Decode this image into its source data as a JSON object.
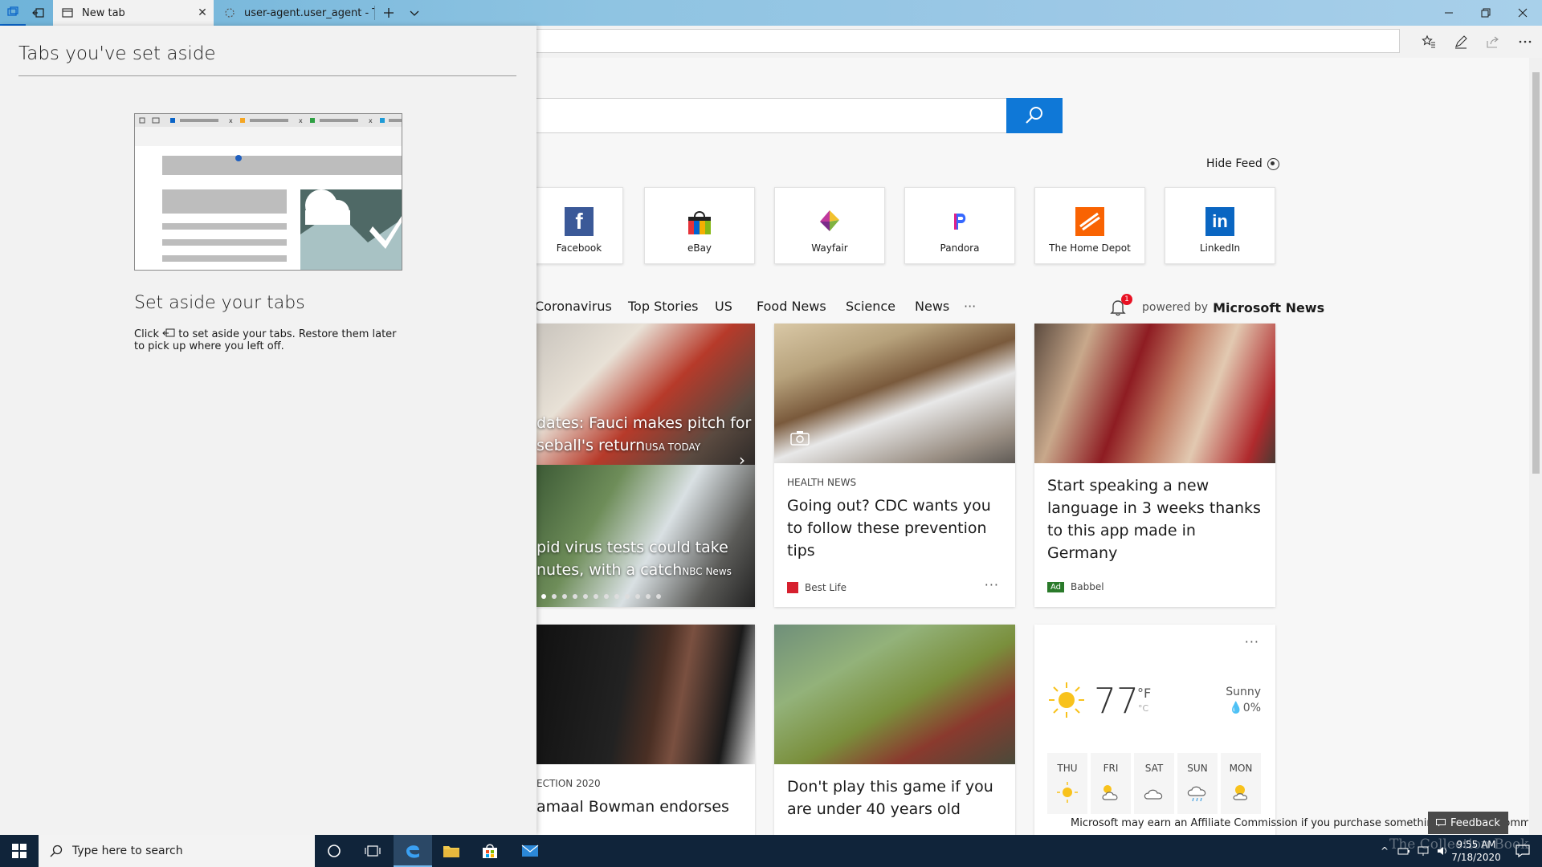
{
  "tabs": [
    {
      "label": "New tab",
      "active": true
    },
    {
      "label": "user-agent.user_agent - The",
      "active": false
    }
  ],
  "page": {
    "hide_feed": "Hide Feed",
    "tiles": [
      {
        "label": "Facebook",
        "color": "#3b5998",
        "logo": "f"
      },
      {
        "label": "eBay",
        "color": "#e53238",
        "logo": ""
      },
      {
        "label": "Wayfair",
        "color": "#7b2a8a",
        "logo": ""
      },
      {
        "label": "Pandora",
        "color": "#3668ff",
        "logo": "P"
      },
      {
        "label": "The Home Depot",
        "color": "#f96302",
        "logo": ""
      },
      {
        "label": "LinkedIn",
        "color": "#0a66c2",
        "logo": "in"
      }
    ],
    "nav": [
      "Coronavirus",
      "Top Stories",
      "US",
      "Food News",
      "Science",
      "News",
      "···"
    ],
    "bell_count": "1",
    "powered_prefix": "powered by",
    "powered_brand": "Microsoft News",
    "carousel": {
      "item1_title": "dates: Fauci makes pitch for",
      "item1_title2": "seball's return",
      "item1_source": "USA TODAY",
      "item2_title": "pid virus tests could take",
      "item2_title2": "nutes, with a catch",
      "item2_source": "NBC News"
    },
    "card_cdc": {
      "category": "HEALTH NEWS",
      "title": "Going out? CDC wants you to follow these prevention tips",
      "source": "Best Life",
      "more": "···"
    },
    "card_babbel": {
      "title": "Start speaking a new language in 3 weeks thanks to this app made in Germany",
      "ad_label": "Ad",
      "source": "Babbel"
    },
    "card_election": {
      "category": "ECTION 2020",
      "title": "amaal Bowman endorses"
    },
    "card_game": {
      "title": "Don't play this game if you are under 40 years old"
    },
    "weather": {
      "more": "···",
      "temp": "77",
      "unit_f": "°F",
      "unit_c": "°C",
      "condition": "Sunny",
      "precip": "0%",
      "days": [
        "THU",
        "FRI",
        "SAT",
        "SUN",
        "MON"
      ]
    },
    "affiliate": "Microsoft may earn an Affiliate Commission if you purchase something through recommended links in this page.",
    "feedback": "Feedback"
  },
  "aside": {
    "title": "Tabs you've set aside",
    "heading": "Set aside your tabs",
    "desc_before": "Click",
    "desc_after": "to set aside your tabs. Restore them later to pick up where you left off."
  },
  "taskbar": {
    "search_placeholder": "Type here to search",
    "time": "9:55 AM",
    "date": "7/18/2020"
  },
  "watermark": "The Collection Book"
}
